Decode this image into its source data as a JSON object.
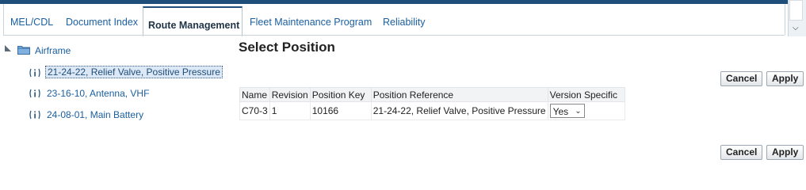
{
  "tabs": [
    {
      "label": "MEL/CDL",
      "active": false
    },
    {
      "label": "Document Index",
      "active": false
    },
    {
      "label": "Route Management",
      "active": true
    },
    {
      "label": "Fleet Maintenance Program",
      "active": false
    },
    {
      "label": "Reliability",
      "active": false
    }
  ],
  "tree": {
    "root": {
      "label": "Airframe",
      "icon": "folder-icon"
    },
    "items": [
      {
        "label": "21-24-22, Relief Valve, Positive Pressure",
        "selected": true,
        "icon": "info-icon"
      },
      {
        "label": "23-16-10, Antenna, VHF",
        "selected": false,
        "icon": "info-icon"
      },
      {
        "label": "24-08-01, Main Battery",
        "selected": false,
        "icon": "info-icon"
      }
    ]
  },
  "main": {
    "title": "Select Position",
    "buttons": {
      "cancel": "Cancel",
      "apply": "Apply"
    },
    "table": {
      "headers": [
        "Name",
        "Revision",
        "Position Key",
        "Position Reference",
        "Version Specific"
      ],
      "rows": [
        {
          "name": "C70-3",
          "revision": "1",
          "position_key": "10166",
          "position_reference": "21-24-22, Relief Valve, Positive Pressure",
          "version_specific": "Yes"
        }
      ]
    }
  },
  "colors": {
    "accent": "#1f4e7a",
    "link": "#1a5fa0"
  }
}
